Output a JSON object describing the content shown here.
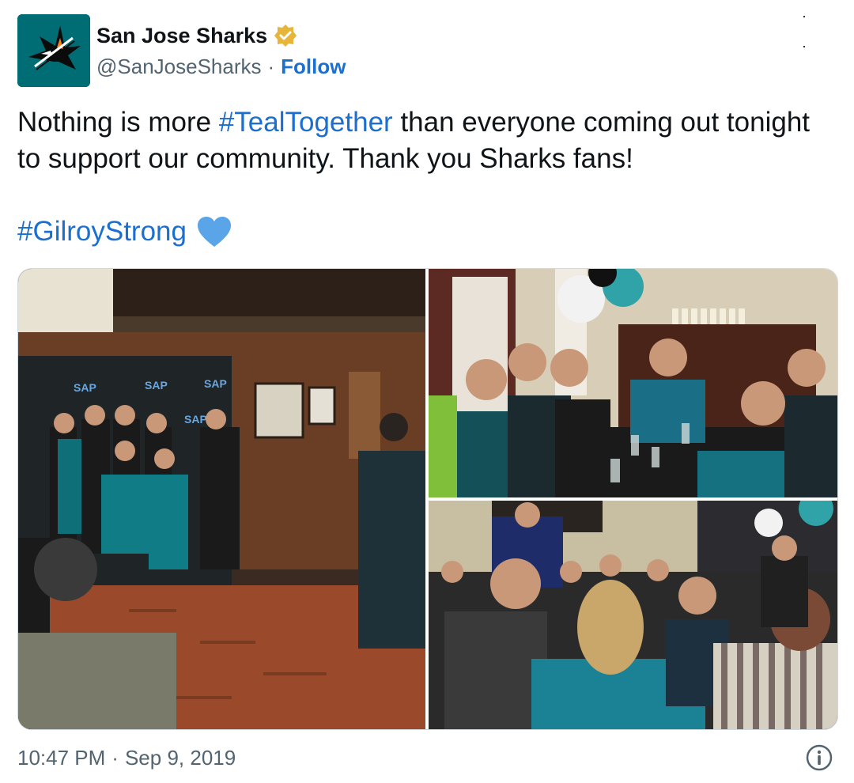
{
  "author": {
    "display_name": "San Jose Sharks",
    "handle": "@SanJoseSharks",
    "separator": "·",
    "follow_label": "Follow",
    "verified_icon": "verified-badge-icon",
    "avatar_icon": "sharks-logo-icon"
  },
  "tweet": {
    "text_prefix": "Nothing is more ",
    "hashtag_1": "#TealTogether",
    "text_suffix": " than everyone coming out tonight to support our community. Thank you Sharks fans!",
    "hashtag_2": "#GilroyStrong",
    "emoji_icon": "blue-heart-icon"
  },
  "media": {
    "photos": [
      {
        "position": "left",
        "subject": "team-photo"
      },
      {
        "position": "top-right",
        "subject": "fans-table"
      },
      {
        "position": "bottom-right",
        "subject": "restaurant-crowd"
      }
    ]
  },
  "footer": {
    "time": "10:47 PM",
    "separator": "·",
    "date": "Sep 9, 2019",
    "info_icon": "info-icon"
  },
  "colors": {
    "link": "#1b6fcf",
    "muted": "#536471",
    "brand_teal": "#006d75",
    "verified_gold": "#e6b53a",
    "heart_blue": "#5aa4e8"
  }
}
